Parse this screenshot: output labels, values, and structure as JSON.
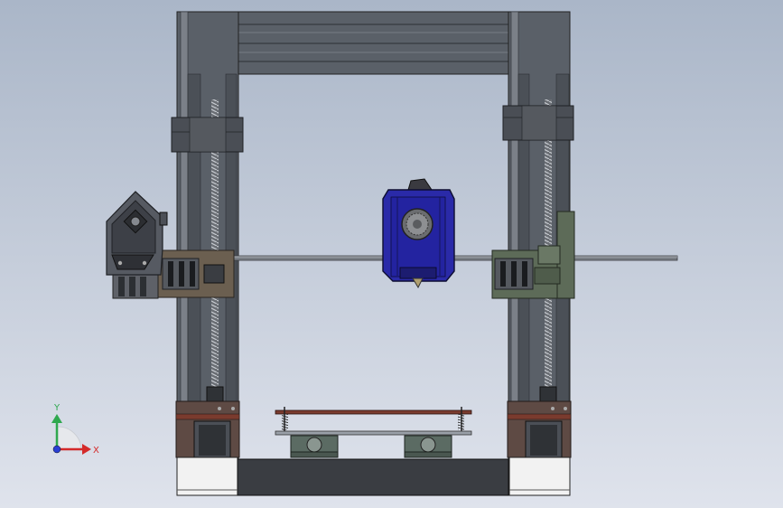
{
  "viewport": {
    "background_top": "#aab6c8",
    "background_bottom": "#dfe3ec"
  },
  "triad": {
    "y_label": "Y",
    "x_label": "X",
    "y_color": "#2fa84f",
    "x_color": "#d42a2a",
    "z_color": "#2a3fd4"
  },
  "colors": {
    "frame": "#5a6068",
    "frame_dark": "#3c4046",
    "rail": "#80868e",
    "carriage_olive": "#5d6b58",
    "carriage_brown": "#6b5f50",
    "hotend_blue": "#2a2aa8",
    "bed_wood": "#7a3b2e",
    "base_black": "#3a3d42",
    "stepper": "#4b4f56"
  }
}
